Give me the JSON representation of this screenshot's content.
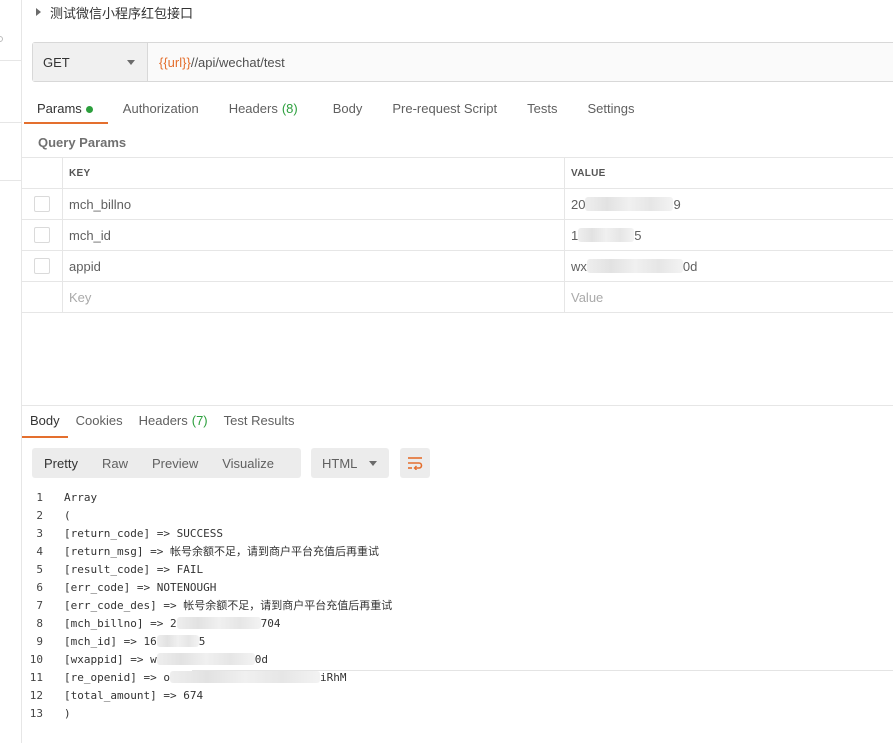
{
  "request": {
    "title": "测试微信小程序红包接口",
    "method": "GET",
    "url_var": "{{url}}",
    "url_path": "//api/wechat/test"
  },
  "request_tabs": [
    {
      "label": "Params",
      "dot": true
    },
    {
      "label": "Authorization"
    },
    {
      "label": "Headers",
      "count": "(8)"
    },
    {
      "label": "Body"
    },
    {
      "label": "Pre-request Script"
    },
    {
      "label": "Tests"
    },
    {
      "label": "Settings"
    }
  ],
  "query_params": {
    "label": "Query Params",
    "columns": {
      "key": "KEY",
      "value": "VALUE"
    },
    "rows": [
      {
        "key": "mch_billno",
        "value_start": "20",
        "value_end": "9"
      },
      {
        "key": "mch_id",
        "value_start": "1",
        "value_end": "5"
      },
      {
        "key": "appid",
        "value_start": "wx",
        "value_end": "0d"
      }
    ],
    "placeholder": {
      "key": "Key",
      "value": "Value"
    }
  },
  "response_tabs": [
    {
      "label": "Body"
    },
    {
      "label": "Cookies"
    },
    {
      "label": "Headers",
      "count": "(7)"
    },
    {
      "label": "Test Results"
    }
  ],
  "response_view": {
    "buttons": [
      "Pretty",
      "Raw",
      "Preview",
      "Visualize"
    ],
    "format": "HTML"
  },
  "code_lines": [
    {
      "n": "1",
      "text": "Array"
    },
    {
      "n": "2",
      "text": "("
    },
    {
      "n": "3",
      "text": "[return_code] => SUCCESS"
    },
    {
      "n": "4",
      "text": "[return_msg] => 帐号余额不足，请到商户平台充值后再重试"
    },
    {
      "n": "5",
      "text": "[result_code] => FAIL"
    },
    {
      "n": "6",
      "text": "[err_code] => NOTENOUGH"
    },
    {
      "n": "7",
      "text": "[err_code_des] => 帐号余额不足，请到商户平台充值后再重试"
    },
    {
      "n": "8",
      "text": "[mch_billno] => 2",
      "tail": "704"
    },
    {
      "n": "9",
      "text": "[mch_id] => 16",
      "tail": "5"
    },
    {
      "n": "10",
      "text": "[wxappid] => w",
      "tail": "0d"
    },
    {
      "n": "11",
      "text": "[re_openid] => o",
      "tail": "iRhM"
    },
    {
      "n": "12",
      "text": "[total_amount] => 674"
    },
    {
      "n": "13",
      "text": ")"
    }
  ],
  "colors": {
    "accent": "#e46f2e",
    "count_green": "#2c9f3d"
  }
}
